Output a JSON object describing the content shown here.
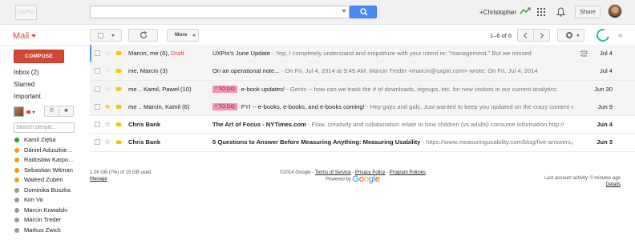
{
  "header": {
    "logo_text": "UXPin",
    "search_value": "",
    "user_name": "+Christopher",
    "share_label": "Share"
  },
  "toolbar": {
    "mail_label": "Mail",
    "more_label": "More",
    "page_count": "1–6 of 6"
  },
  "sidebar": {
    "compose_label": "COMPOSE",
    "items": [
      {
        "label": "Inbox (2)",
        "active": true
      },
      {
        "label": "Starred",
        "active": false
      },
      {
        "label": "Important",
        "active": false
      }
    ],
    "people_search_placeholder": "Search people...",
    "contacts": [
      {
        "name": "Kamil Zięba",
        "status_color": "#2ca02c"
      },
      {
        "name": "Daniel Aduszkie…",
        "status_color": "#f39c12"
      },
      {
        "name": "Radosław Karpo…",
        "status_color": "#f39c12"
      },
      {
        "name": "Sebastian Witman",
        "status_color": "#f39c12"
      },
      {
        "name": "Waleed Zuberi",
        "status_color": "#f39c12"
      },
      {
        "name": "Dominika Buszka",
        "status_color": "#999999"
      },
      {
        "name": "Kim Vo",
        "status_color": "#999999"
      },
      {
        "name": "Marcin Kowalski",
        "status_color": "#999999"
      },
      {
        "name": "Marcin Treder",
        "status_color": "#999999"
      },
      {
        "name": "Markus Zwick",
        "status_color": "#999999"
      }
    ]
  },
  "messages": [
    {
      "sender": "Marcin, me (6), ",
      "draft": "Draft",
      "label": "",
      "subject": "UXPin's June Update",
      "snippet": " - Yep, I completely understand and empathize with your intent re: \"management.\" But we missed",
      "date": "Jul 4",
      "starred": false,
      "unread": false,
      "attachment": true
    },
    {
      "sender": "me, Marcin (3)",
      "draft": "",
      "label": "",
      "subject": "On an operational note...",
      "snippet": " - On Fri, Jul 4, 2014 at 9:49 AM, Marcin Treder <marcin@uxpin.com> wrote: On Fri, Jul 4, 2014",
      "date": "Jul 4",
      "starred": false,
      "unread": false,
      "attachment": false
    },
    {
      "sender": "me .. Kamil, Paweł (10)",
      "draft": "",
      "label": "* TO DO",
      "subject": "e-book updates!",
      "snippet": " - Gents -- how can we track the # of downloads, signups, etc. for new visitors in our current analytics",
      "date": "Jun 30",
      "starred": false,
      "unread": false,
      "attachment": false
    },
    {
      "sender": "me .. Marcin, Kamil (6)",
      "draft": "",
      "label": "* TO DO",
      "subject": "FYI -- e-books, e-books, and e-books coming!",
      "snippet": " - Hey guys and gals, Just wanted to keep you updated on the crazy content we're at",
      "date": "Jun 9",
      "starred": true,
      "unread": false,
      "attachment": false
    },
    {
      "sender": "Chris Bank",
      "draft": "",
      "label": "",
      "subject": "The Art of Focus - NYTimes.com",
      "snippet": " - Flow, creativity and collaboration relate to how children (vs adults) consume information http://",
      "date": "Jun 4",
      "starred": false,
      "unread": true,
      "attachment": false
    },
    {
      "sender": "Chris Bank",
      "draft": "",
      "label": "",
      "subject": "5 Questions to Answer Before Measuring Anything: Measuring Usability",
      "snippet": " - https://www.measuringusability.com/blog/five-answers.php _ S",
      "date": "Jun 3",
      "starred": false,
      "unread": true,
      "attachment": false
    }
  ],
  "footer": {
    "storage": "1.06 GB (7%) of 15 GB used",
    "manage": "Manage",
    "copyright": "©2014 Google - ",
    "terms": "Terms of Service",
    "privacy": "Privacy Policy",
    "program": "Program Policies",
    "powered_by": "Powered by",
    "google": "Google",
    "last_activity": "Last account activity: 0 minutes ago",
    "details": "Details"
  }
}
